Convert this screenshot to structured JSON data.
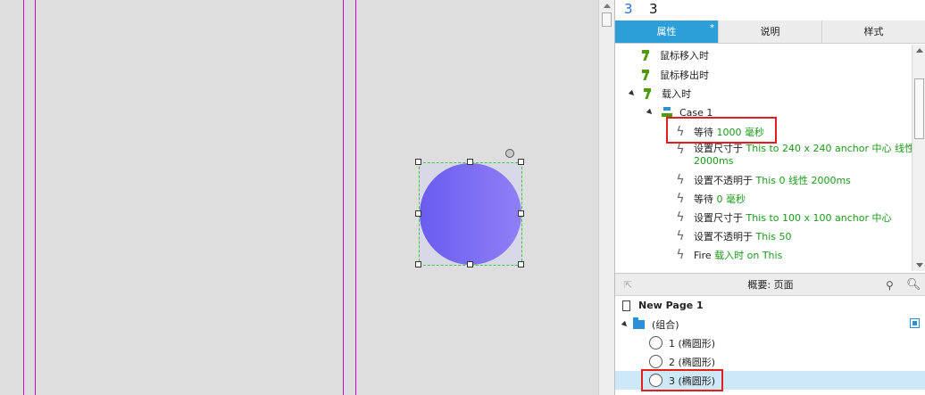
{
  "widget": {
    "number": "3",
    "name": "3"
  },
  "tabs": [
    {
      "label": "属性",
      "marker": "*"
    },
    {
      "label": "说明"
    },
    {
      "label": "样式"
    }
  ],
  "interactions": {
    "events": [
      {
        "label": "鼠标移入时"
      },
      {
        "label": "鼠标移出时"
      },
      {
        "label": "载入时"
      }
    ],
    "case_label": "Case 1",
    "actions": [
      {
        "action": "等待",
        "detail": "1000 毫秒"
      },
      {
        "action": "设置尺寸于",
        "detail": "This to 240 x 240 anchor 中心 线性",
        "detail2": "2000ms"
      },
      {
        "action": "设置不透明于",
        "detail": "This 0 线性 2000ms"
      },
      {
        "action": "等待",
        "detail": "0 毫秒"
      },
      {
        "action": "设置尺寸于",
        "detail": "This to 100 x 100 anchor 中心"
      },
      {
        "action": "设置不透明于",
        "detail": "This 50"
      },
      {
        "action": "Fire",
        "detail": "载入时 on This"
      }
    ]
  },
  "outline": {
    "title": "概要: 页面",
    "page": "New Page 1",
    "group": "(组合)",
    "items": [
      {
        "label": "1 (椭圆形)"
      },
      {
        "label": "2 (椭圆形)"
      },
      {
        "label": "3 (椭圆形)"
      }
    ]
  },
  "colors": {
    "accent": "#2c9fd9",
    "highlight": "#e02020",
    "action_detail": "#1a9a1a",
    "circle_gradient_start": "#6a5cf0",
    "circle_gradient_end": "#8f80f6",
    "guide": "#d000d0"
  },
  "icons": {
    "event": "event-flag-icon",
    "action": "lightning-icon",
    "case": "case-icon",
    "page": "page-icon",
    "group": "folder-icon",
    "shape": "ellipse-icon",
    "filter": "filter-icon",
    "search": "search-icon"
  }
}
